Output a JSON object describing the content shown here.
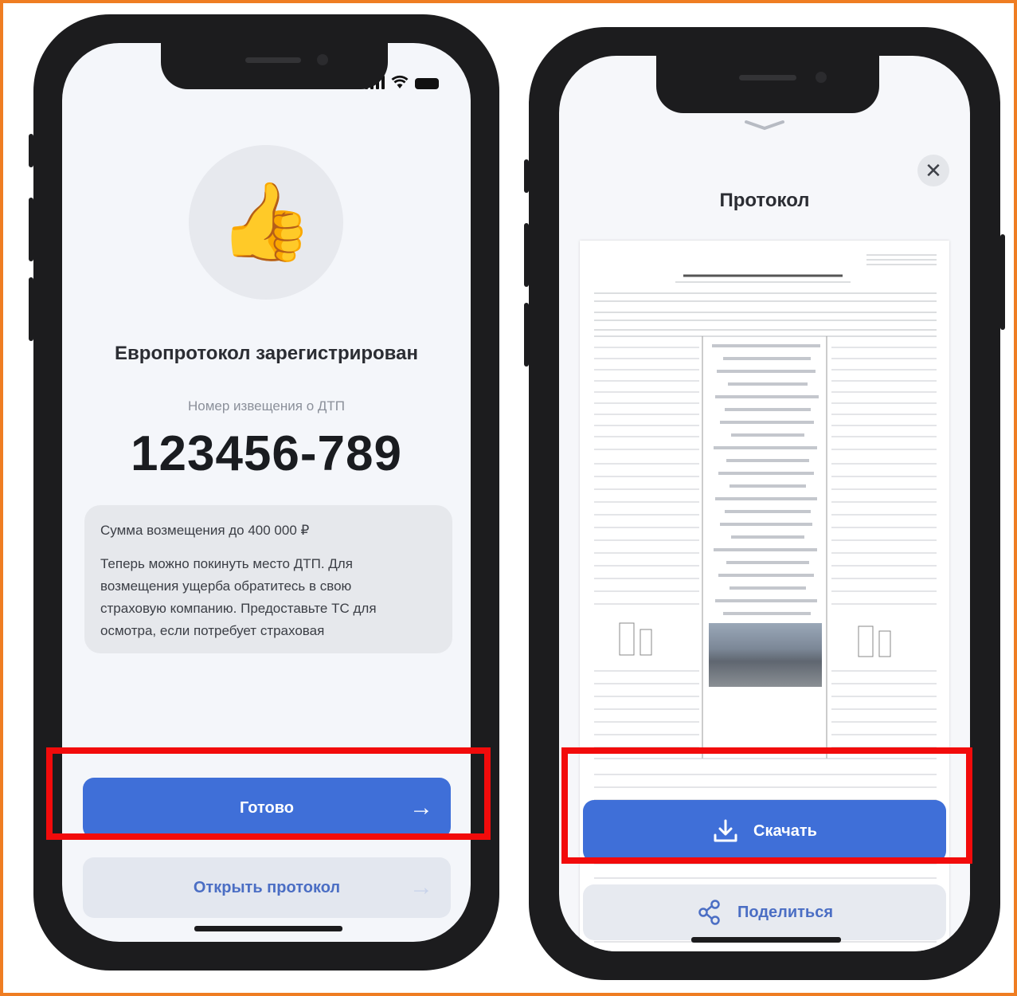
{
  "left_screen": {
    "title": "Европротокол зарегистрирован",
    "notice_label": "Номер извещения о ДТП",
    "notice_number": "123456-789",
    "thumb_emoji": "👍",
    "info": {
      "amount": "Сумма возмещения до 400 000 ₽",
      "line1": "Теперь можно покинуть место ДТП. Для",
      "line2": "возмещения ущерба обратитесь в свою",
      "line3": "страховую компанию. Предоставьте ТС для",
      "line4": "осмотра, если потребует страховая"
    },
    "done_button": "Готово",
    "open_protocol_button": "Открыть протокол",
    "arrow": "→"
  },
  "right_screen": {
    "title": "Протокол",
    "close_glyph": "✕",
    "download_button": "Скачать",
    "share_button": "Поделиться"
  },
  "colors": {
    "accent": "#3f6fd8",
    "highlight": "#f20b0b",
    "frame": "#ef7d22"
  },
  "icons": [
    "thumbs-up-icon",
    "arrow-right-icon",
    "close-icon",
    "download-icon",
    "share-icon",
    "chevron-down-icon",
    "signal-icon",
    "wifi-icon",
    "battery-icon"
  ]
}
